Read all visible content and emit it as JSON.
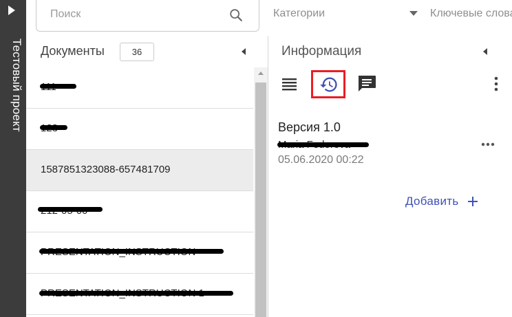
{
  "sidebar": {
    "project_title": "Тестовый проект"
  },
  "search": {
    "placeholder": "Поиск"
  },
  "filters": {
    "categories_label": "Категории",
    "keywords_label": "Ключевые слова"
  },
  "documents": {
    "title": "Документы",
    "count": "36",
    "items": [
      {
        "label": "111",
        "redacted": true
      },
      {
        "label": "123",
        "redacted": true
      },
      {
        "label": "1587851323088-657481709",
        "redacted": false,
        "selected": true
      },
      {
        "label": "212-05-00",
        "redacted": true
      },
      {
        "label": "PRESENTATION_INSTRUCTION",
        "redacted": true
      },
      {
        "label": "PRESENTATION_INSTRUCTION 1",
        "redacted": true
      }
    ]
  },
  "info": {
    "title": "Информация",
    "tabs": [
      {
        "name": "details",
        "icon": "list-icon"
      },
      {
        "name": "history",
        "icon": "history-icon",
        "active": true,
        "highlight_color": "#ec1c24"
      },
      {
        "name": "comments",
        "icon": "comment-icon"
      }
    ],
    "version": {
      "title": "Версия 1.0",
      "author": "Maria Fedorova",
      "date": "05.06.2020 00:22"
    },
    "add_label": "Добавить"
  },
  "colors": {
    "accent": "#3f51b5",
    "rail": "#3c3c3c",
    "highlight": "#ec1c24",
    "selected_row": "#ececec"
  }
}
